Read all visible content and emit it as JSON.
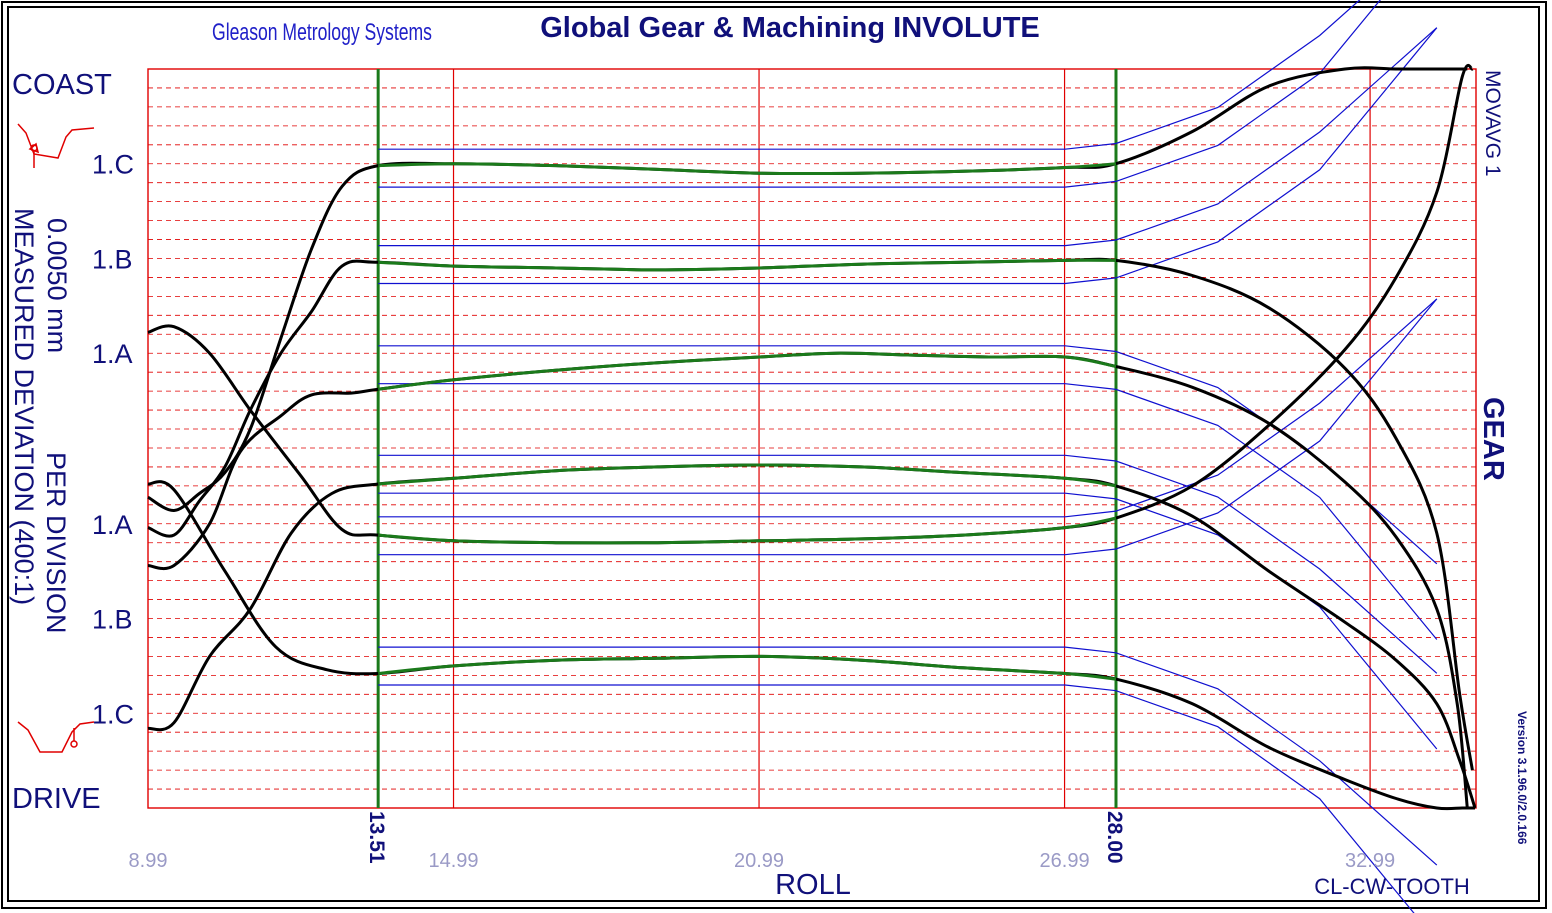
{
  "header": {
    "company": "Gleason Metrology Systems",
    "title": "Global Gear & Machining  INVOLUTE"
  },
  "labels": {
    "coast": "COAST",
    "drive": "DRIVE",
    "scale_line1": "0.0050 mm",
    "scale_line2": "PER DIVISION",
    "scale_line3": "MEASURED DEVIATION (400:1)",
    "gear": "GEAR",
    "movavg": "MOVAVG 1",
    "version": "Version 3.1.96.0/2.0.166",
    "tooth": "CL-CW-TOOTH"
  },
  "colors": {
    "grid": "#e00000",
    "frame": "#000000",
    "text": "#10107a",
    "tick_text": "#9a9ac6",
    "eval_line": "#1b7a1b",
    "tolerance": "#1010d0",
    "trace": "#000000"
  },
  "chart_data": {
    "type": "line",
    "xlabel": "ROLL",
    "x_ticks": [
      8.99,
      14.99,
      20.99,
      26.99,
      32.99
    ],
    "x_tick_labels": [
      "8.99",
      "14.99",
      "20.99",
      "26.99",
      "32.99"
    ],
    "xlim": [
      8.99,
      35.07
    ],
    "eval_range": {
      "start": 13.51,
      "end": 28.0,
      "start_label": "13.51",
      "end_label": "28.00"
    },
    "y_unit": "division",
    "ylim": [
      0,
      39
    ],
    "grid_minor_step": 1,
    "grid": true,
    "series": [
      {
        "name": "1.C",
        "flank": "coast",
        "label_y": 5.0,
        "x": [
          8.99,
          9.5,
          10.2,
          10.8,
          11.6,
          12.2,
          13.0,
          13.51,
          15.0,
          17.0,
          19.0,
          21.0,
          22.5,
          24.0,
          25.5,
          27.0,
          28.0,
          29.5,
          31.0,
          32.5,
          33.5,
          34.3,
          34.7,
          34.9
        ],
        "y": [
          26.2,
          26.2,
          24.0,
          20.2,
          18.3,
          17.2,
          17.1,
          16.9,
          16.4,
          15.9,
          15.5,
          15.2,
          15.0,
          15.1,
          15.2,
          15.2,
          15.7,
          16.8,
          18.7,
          21.8,
          24.7,
          28.5,
          33.5,
          39.0
        ]
      },
      {
        "name": "1.B",
        "flank": "coast",
        "label_y": 10.0,
        "x": [
          8.99,
          9.5,
          10.2,
          11.0,
          11.8,
          12.6,
          13.51,
          15.0,
          17.0,
          19.0,
          21.0,
          23.0,
          25.0,
          27.0,
          28.0,
          29.5,
          31.0,
          32.5,
          33.5,
          34.3,
          34.75,
          35.05
        ],
        "y": [
          34.8,
          34.5,
          31.0,
          28.5,
          24.5,
          22.4,
          21.9,
          21.6,
          21.2,
          21.0,
          20.9,
          21.0,
          21.3,
          21.6,
          22.0,
          23.6,
          26.5,
          29.2,
          31.2,
          33.5,
          36.5,
          39.0
        ]
      },
      {
        "name": "1.A",
        "flank": "coast",
        "label_y": 15.0,
        "x": [
          8.99,
          9.5,
          10.5,
          11.5,
          12.5,
          13.51,
          15.0,
          17.0,
          19.0,
          21.0,
          23.0,
          25.0,
          27.0,
          28.0,
          29.5,
          31.0,
          32.5,
          33.5,
          34.3,
          34.8,
          35.05
        ],
        "y": [
          21.9,
          22.2,
          26.5,
          30.5,
          31.7,
          31.9,
          31.5,
          31.2,
          31.1,
          31.0,
          31.2,
          31.6,
          31.9,
          32.2,
          33.5,
          35.8,
          37.5,
          38.5,
          39.0,
          39.0,
          39.0
        ]
      },
      {
        "name": "1.A",
        "flank": "drive",
        "label_y": 24.0,
        "x": [
          8.99,
          9.5,
          10.2,
          11.0,
          12.0,
          12.8,
          13.51,
          15.0,
          17.0,
          19.0,
          21.0,
          23.0,
          25.0,
          27.0,
          28.0,
          29.5,
          31.0,
          32.5,
          33.5,
          34.3,
          34.8,
          35.0
        ],
        "y": [
          13.9,
          13.6,
          15.0,
          18.0,
          21.5,
          24.3,
          24.6,
          24.9,
          25.0,
          25.0,
          24.9,
          24.8,
          24.6,
          24.2,
          23.7,
          22.0,
          18.8,
          14.8,
          11.0,
          6.5,
          0.4,
          0.0
        ]
      },
      {
        "name": "1.B",
        "flank": "drive",
        "label_y": 29.0,
        "x": [
          8.99,
          9.5,
          10.0,
          10.5,
          11.0,
          11.6,
          12.2,
          12.8,
          13.51,
          15.0,
          17.0,
          19.0,
          21.0,
          23.0,
          25.0,
          27.0,
          28.0,
          29.5,
          31.0,
          32.5,
          33.5,
          34.3,
          34.75,
          35.0
        ],
        "y": [
          24.2,
          24.6,
          22.8,
          21.0,
          18.0,
          15.0,
          12.8,
          10.4,
          10.2,
          10.4,
          10.5,
          10.6,
          10.5,
          10.3,
          10.2,
          10.1,
          10.1,
          10.9,
          12.6,
          15.8,
          19.5,
          24.5,
          33.0,
          37.0
        ]
      },
      {
        "name": "1.C",
        "flank": "drive",
        "label_y": 34.0,
        "x": [
          8.99,
          9.5,
          10.0,
          10.5,
          11.0,
          11.6,
          12.2,
          12.8,
          13.51,
          15.0,
          17.0,
          19.0,
          21.0,
          23.0,
          25.0,
          27.0,
          28.0,
          29.5,
          31.0,
          32.5,
          33.5,
          34.3,
          34.7,
          34.9
        ],
        "y": [
          22.6,
          23.3,
          22.4,
          21.3,
          19.0,
          14.2,
          9.5,
          6.2,
          5.1,
          5.0,
          5.1,
          5.3,
          5.5,
          5.5,
          5.4,
          5.2,
          5.0,
          3.3,
          0.9,
          0.0,
          0.0,
          0.0,
          0.0,
          0.0
        ]
      }
    ]
  }
}
